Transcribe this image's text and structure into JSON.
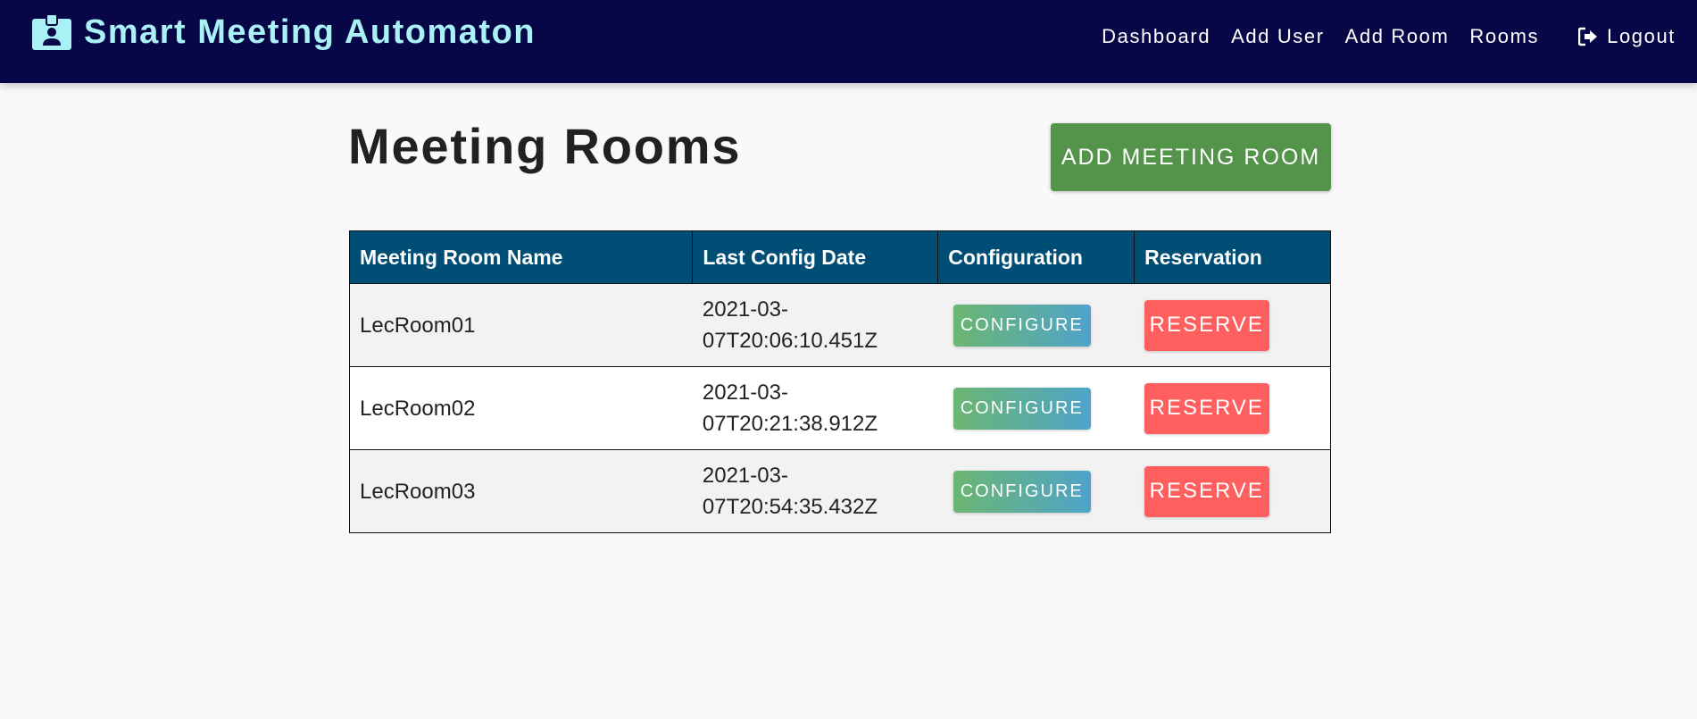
{
  "header": {
    "app_title": "Smart Meeting Automaton",
    "brand_icon": "id-badge-icon",
    "nav": {
      "dashboard": "Dashboard",
      "add_user": "Add User",
      "add_room": "Add Room",
      "rooms": "Rooms",
      "logout": "Logout",
      "logout_icon": "sign-out-icon"
    },
    "colors": {
      "background": "#070748",
      "title": "#a9f1f5"
    }
  },
  "main": {
    "page_title": "Meeting Rooms",
    "add_button_label": "ADD MEETING ROOM",
    "table": {
      "columns": [
        "Meeting Room Name",
        "Last Config Date",
        "Configuration",
        "Reservation"
      ],
      "rows": [
        {
          "name": "LecRoom01",
          "date_line1": "2021-03-",
          "date_line2": "07T20:06:10.451Z",
          "configure_label": "CONFIGURE",
          "reserve_label": "RESERVE"
        },
        {
          "name": "LecRoom02",
          "date_line1": "2021-03-",
          "date_line2": "07T20:21:38.912Z",
          "configure_label": "CONFIGURE",
          "reserve_label": "RESERVE"
        },
        {
          "name": "LecRoom03",
          "date_line1": "2021-03-",
          "date_line2": "07T20:54:35.432Z",
          "configure_label": "CONFIGURE",
          "reserve_label": "RESERVE"
        }
      ]
    },
    "colors": {
      "add_button": "#53944a",
      "table_header": "#004e75",
      "reserve_button": "#ff605f",
      "configure_gradient_start": "#6bb672",
      "configure_gradient_end": "#4fa3c9"
    }
  }
}
